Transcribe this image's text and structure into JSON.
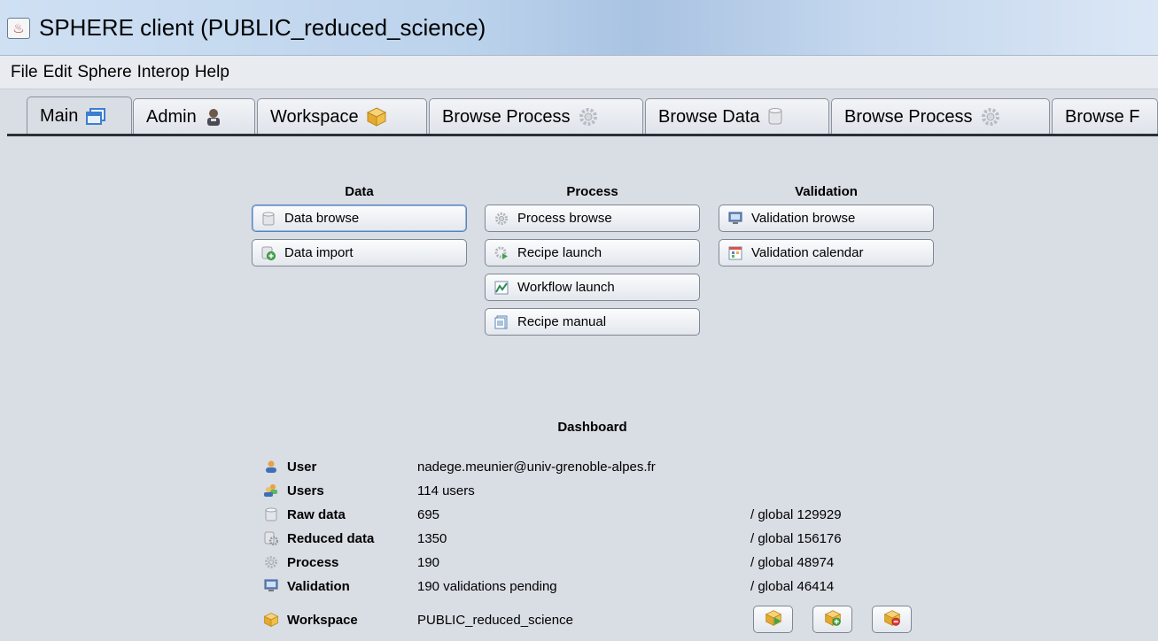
{
  "window": {
    "title": "SPHERE client (PUBLIC_reduced_science)"
  },
  "menu": [
    "File",
    "Edit",
    "Sphere",
    "Interop",
    "Help"
  ],
  "tabs": [
    {
      "label": "Main",
      "icon": "window-icon",
      "active": true
    },
    {
      "label": "Admin",
      "icon": "admin-user-icon",
      "active": false
    },
    {
      "label": "Workspace",
      "icon": "workspace-cube-icon",
      "active": false
    },
    {
      "label": "Browse Process",
      "icon": "gear-icon",
      "active": false
    },
    {
      "label": "Browse Data",
      "icon": "database-icon",
      "active": false
    },
    {
      "label": "Browse Process",
      "icon": "gear-icon",
      "active": false
    },
    {
      "label": "Browse F",
      "icon": "",
      "active": false
    }
  ],
  "sections": {
    "data": {
      "heading": "Data",
      "buttons": [
        {
          "label": "Data browse",
          "icon": "database-icon"
        },
        {
          "label": "Data import",
          "icon": "database-add-icon"
        }
      ]
    },
    "process": {
      "heading": "Process",
      "buttons": [
        {
          "label": "Process browse",
          "icon": "gear-icon"
        },
        {
          "label": "Recipe launch",
          "icon": "gear-run-icon"
        },
        {
          "label": "Workflow launch",
          "icon": "workflow-chart-icon"
        },
        {
          "label": "Recipe manual",
          "icon": "document-icon"
        }
      ]
    },
    "validation": {
      "heading": "Validation",
      "buttons": [
        {
          "label": "Validation browse",
          "icon": "monitor-icon"
        },
        {
          "label": "Validation calendar",
          "icon": "calendar-icon"
        }
      ]
    }
  },
  "dashboard": {
    "heading": "Dashboard",
    "rows": [
      {
        "label": "User",
        "value": "nadege.meunier@univ-grenoble-alpes.fr",
        "global": "",
        "icon": "user-icon"
      },
      {
        "label": "Users",
        "value": "114 users",
        "global": "",
        "icon": "users-icon"
      },
      {
        "label": "Raw data",
        "value": "695",
        "global": "/ global 129929",
        "icon": "database-icon"
      },
      {
        "label": "Reduced data",
        "value": "1350",
        "global": "/ global 156176",
        "icon": "reduced-data-icon"
      },
      {
        "label": "Process",
        "value": "190",
        "global": "/ global 48974",
        "icon": "gear-icon"
      },
      {
        "label": "Validation",
        "value": "190 validations pending",
        "global": "/ global 46414",
        "icon": "monitor-icon"
      },
      {
        "label": "Workspace",
        "value": "PUBLIC_reduced_science",
        "global": "",
        "icon": "workspace-cube-icon"
      }
    ],
    "workspace_buttons": [
      {
        "icon": "workspace-open-icon"
      },
      {
        "icon": "workspace-add-icon"
      },
      {
        "icon": "workspace-remove-icon"
      }
    ]
  },
  "colors": {
    "background": "#d9dde4",
    "titlebar": "#bcd3ec",
    "tab_baseline": "#2b2f36"
  }
}
